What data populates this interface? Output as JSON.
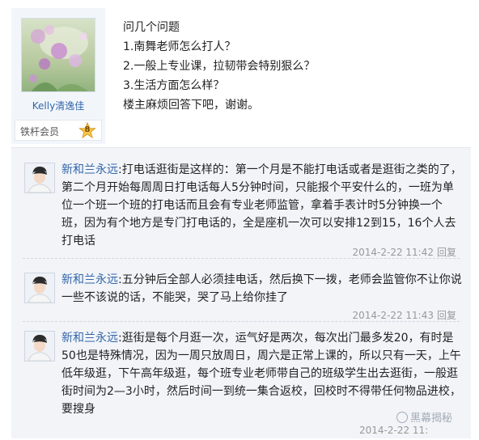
{
  "post": {
    "author": "Kelly清逸佳",
    "rank_label": "铁杆会员",
    "rank_level": "8",
    "lines": [
      "问几个问题",
      "1.南舞老师怎么打人？",
      "2.一般上专业课，拉韧带会特别狠么？",
      "3.生活方面怎么样？",
      "楼主麻烦回答下吧，谢谢。"
    ]
  },
  "replies": [
    {
      "author": "新和兰永远",
      "separator": ":",
      "text": "打电话逛街是这样的：第一个月是不能打电话或者是逛街之类的了，第二个月开始每周周日打电话每人5分钟时间，只能报个平安什么的，一班为单位一个班一个班的打电话而且会有专业老师监管，拿着手表计时5分钟换一个班，因为有个地方是专门打电话的，全是座机一次可以安排12到15，16个人去打电话",
      "time": "2014-2-22 11:42",
      "reply_link": "回复"
    },
    {
      "author": "新和兰永远",
      "separator": ":",
      "text": "五分钟后全部人必须挂电话，然后换下一拨，老师会监管你不让你说一些不该说的话，不能哭，哭了马上给你挂了",
      "time": "2014-2-22 11:43",
      "reply_link": "回复"
    },
    {
      "author": "新和兰永远",
      "separator": ":",
      "text": "逛街是每个月逛一次，运气好是两次，每次出门最多发20，有时是50也是特殊情况，因为一周只放周日，周六是正常上课的，所以只有一天，上午低年级逛，下午高年级逛，每个班专业老师带自己的班级学生出去逛街，一般逛街时间为2—3小时，然后时间一到统一集合返校，回校时不得带任何物品进校，要搜身",
      "time": "2014-2-22 11:",
      "reply_link": ""
    }
  ],
  "watermark": "黑幕揭秘"
}
